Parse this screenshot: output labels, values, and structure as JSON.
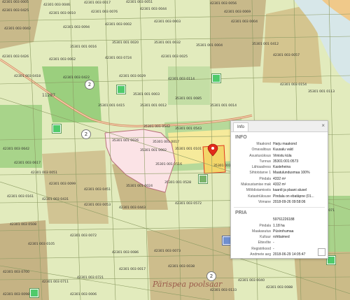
{
  "map": {
    "place_name": "Pärispea poolsaar",
    "road_label": "11287",
    "parcel_labels": [
      "42301 003 0005",
      "42301 003 0046",
      "42301 003 0017",
      "42301 003 0051",
      "42301 003 0056",
      "42301 003 0425",
      "42301 003 0010",
      "42301 003 0076",
      "42301 003 0044",
      "42301 003 0069",
      "42301 003 0042",
      "42301 003 0094",
      "42301 003 0002",
      "42301 003 0003",
      "42301 003 0004",
      "35301 001 0016",
      "35301 001 0020",
      "35301 001 0032",
      "35301 001 0004",
      "35301 001 0412",
      "42301 003 0426",
      "42301 003 0062",
      "42301 003 0724",
      "42301 003 0025",
      "42301 003 0057",
      "42301 003 0418",
      "42301 003 0422",
      "42301 003 0029",
      "42301 003 0114",
      "42301 003 0154",
      "35301 001 0003",
      "35301 001 0415",
      "35301 001 0012",
      "35301 001 0085",
      "35301 001 0014",
      "35301 001 0026",
      "35301 001 0002",
      "35301 001 0017",
      "35301 001 0101",
      "35301 001 0516",
      "35301 001 0542",
      "35301 001 0543",
      "35301 001 0573",
      "35301 001 0024",
      "35301 001 0528",
      "42301 003 0642",
      "42301 003 0617",
      "42301 003 0051",
      "42301 003 0099",
      "42301 003 0451",
      "42301 003 0161",
      "42301 003 0431",
      "42301 003 0053",
      "42301 003 0443",
      "42301 003 0572",
      "42301 003 0508",
      "42301 003 0105",
      "42301 003 0072",
      "42301 003 0086",
      "42301 003 0073",
      "42301 003 0700",
      "42301 003 0711",
      "42301 003 0721",
      "42301 003 0017",
      "42301 003 0038",
      "42301 003 0098",
      "42301 003 0006",
      "42301 003 0133",
      "42301 003 0040",
      "42301 003 0088",
      "35301 001 0089",
      "35301 001 0066",
      "35301 001 0074",
      "35301 001 0071",
      "35301 001 0113"
    ],
    "clusters": [
      "2",
      "2",
      "2"
    ]
  },
  "popup": {
    "tab_label": "Info",
    "close_icon": "×",
    "info_title": "INFO",
    "info_rows": [
      {
        "key": "Maakond",
        "value": "Harju maakond"
      },
      {
        "key": "Omavalitsus",
        "value": "Kuusalu vald"
      },
      {
        "key": "Asustusüksus",
        "value": "Viinistu küla"
      },
      {
        "key": "Tunnus",
        "value": "35301:001:0573"
      },
      {
        "key": "Lähiaadress",
        "value": "Kasteheina"
      },
      {
        "key": "Sihtotstarve 1",
        "value": "Maatulundusmaa 100%"
      },
      {
        "key": "Pindala",
        "value": "4332 m²"
      },
      {
        "key": "Maksustamise mak",
        "value": "4332 m²"
      },
      {
        "key": "Mõõdistamisviis",
        "value": "kaardi ja plaani alusel"
      },
      {
        "key": "Katastriüksuse",
        "value": "Pindala on ebatäpne (01..."
      },
      {
        "key": "Viimane",
        "value": "2018-09-26 09:58:06"
      }
    ],
    "pria_title": "PRIA",
    "pria_rows": [
      {
        "key": "",
        "value": "59761226188"
      },
      {
        "key": "Pindala",
        "value": "1.18 ha"
      },
      {
        "key": "Maakasutus",
        "value": "Püsirohumaa"
      },
      {
        "key": "Kultuur",
        "value": "rohttaimed"
      },
      {
        "key": "Ettevõte",
        "value": "-"
      },
      {
        "key": "Registrikood",
        "value": "-"
      },
      {
        "key": "Andmete aeg",
        "value": "2018-06-29 14:05:47"
      }
    ]
  }
}
